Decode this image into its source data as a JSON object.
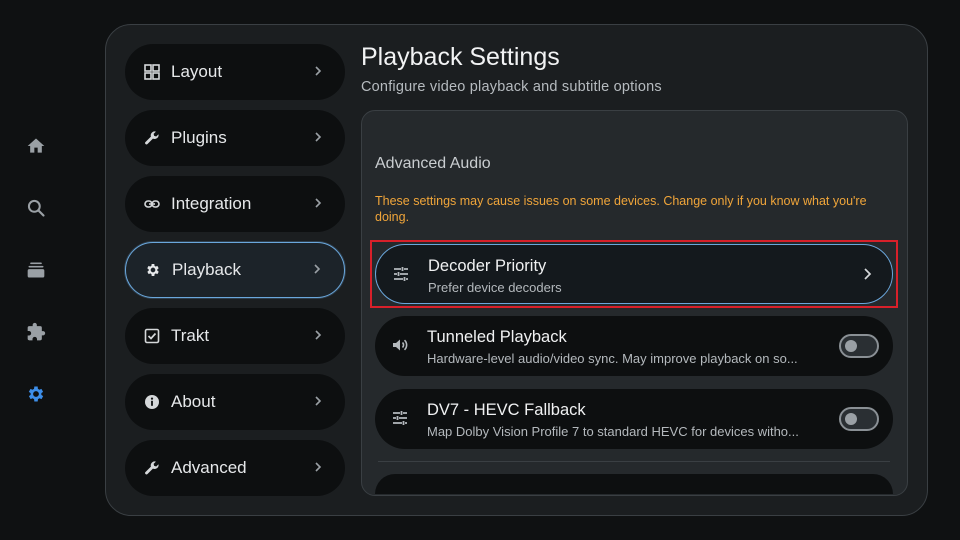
{
  "rail": {
    "items": [
      {
        "icon": "home-icon",
        "active": false
      },
      {
        "icon": "search-icon",
        "active": false
      },
      {
        "icon": "library-icon",
        "active": false
      },
      {
        "icon": "puzzle-icon",
        "active": false
      },
      {
        "icon": "gear-icon",
        "active": true
      }
    ],
    "accent": "#3d8ee8"
  },
  "nav": {
    "items": [
      {
        "label": "Layout",
        "icon": "grid-icon"
      },
      {
        "label": "Plugins",
        "icon": "wrench-icon"
      },
      {
        "label": "Integration",
        "icon": "link-icon"
      },
      {
        "label": "Playback",
        "icon": "gear-icon",
        "active": true
      },
      {
        "label": "Trakt",
        "icon": "checkbox-icon"
      },
      {
        "label": "About",
        "icon": "info-icon"
      },
      {
        "label": "Advanced",
        "icon": "wrench-icon"
      }
    ]
  },
  "header": {
    "title": "Playback Settings",
    "subtitle": "Configure video playback and subtitle options"
  },
  "section": {
    "title": "Advanced Audio",
    "warning": "These settings may cause issues on some devices. Change only if you know what you're doing."
  },
  "settings": [
    {
      "title": "Decoder Priority",
      "description": "Prefer device decoders",
      "icon": "sliders-icon",
      "control": "chevron",
      "focused": true
    },
    {
      "title": "Tunneled Playback",
      "description": "Hardware-level audio/video sync. May improve playback on so...",
      "icon": "speaker-icon",
      "control": "toggle",
      "value": false
    },
    {
      "title": "DV7 - HEVC Fallback",
      "description": "Map Dolby Vision Profile 7 to standard HEVC for devices witho...",
      "icon": "sliders-icon",
      "control": "toggle",
      "value": false
    }
  ],
  "colors": {
    "warning": "#f0a53a",
    "focus_border": "#6aa7dc",
    "highlight": "#d8202a"
  }
}
